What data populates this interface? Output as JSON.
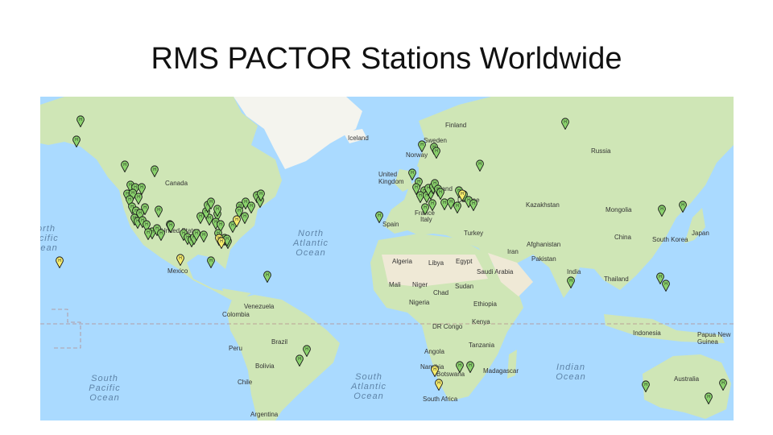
{
  "title": "RMS PACTOR Stations Worldwide",
  "colors": {
    "ocean": "#aadaff",
    "land": "#cfe6b6",
    "land_dark": "#b7d79a",
    "desert": "#efe9d6",
    "ice": "#f4f4ee",
    "pin_green": "#8ad26c",
    "pin_yellow": "#f6ec6c",
    "pin_stroke": "#1b1b1b"
  },
  "country_labels": [
    "Finland",
    "Sweden",
    "Iceland",
    "Norway",
    "Russia",
    "Canada",
    "United Kingdom",
    "Poland",
    "Ukraine",
    "Kazakhstan",
    "Mongolia",
    "France",
    "Italy",
    "Spain",
    "Turkey",
    "China",
    "Japan",
    "South Korea",
    "United States",
    "Afghanistan",
    "Iran",
    "Pakistan",
    "Mexico",
    "Algeria",
    "Libya",
    "Egypt",
    "Saudi Arabia",
    "India",
    "Thailand",
    "Mali",
    "Niger",
    "Chad",
    "Sudan",
    "Ethiopia",
    "Nigeria",
    "Venezuela",
    "Colombia",
    "Kenya",
    "DR Congo",
    "Indonesia",
    "Papua New Guinea",
    "Peru",
    "Brazil",
    "Angola",
    "Tanzania",
    "Namibia",
    "Botswana",
    "Madagascar",
    "Bolivia",
    "Chile",
    "South Africa",
    "Australia",
    "Argentina"
  ],
  "ocean_labels": [
    "North Atlantic Ocean",
    "North Pacific Ocean",
    "South Pacific Ocean",
    "South Atlantic Ocean",
    "Indian Ocean"
  ],
  "pin_letter": "H",
  "pins": {
    "green": 96,
    "yellow": 6
  }
}
